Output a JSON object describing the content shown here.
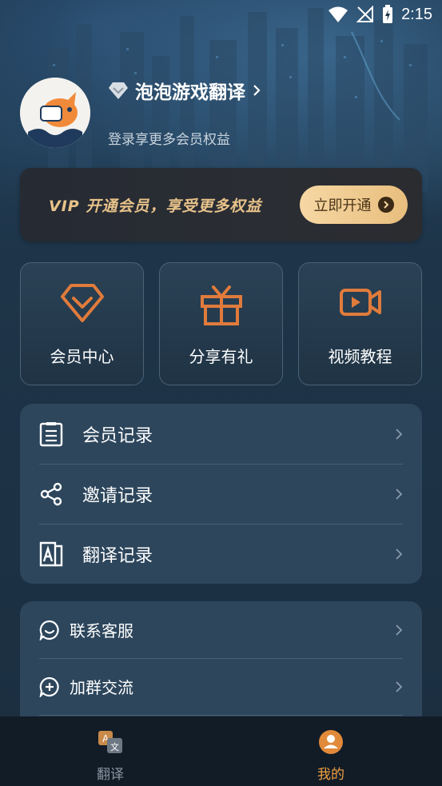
{
  "status_bar": {
    "time": "2:15"
  },
  "profile": {
    "app_name": "泡泡游戏翻译",
    "subtitle": "登录享更多会员权益"
  },
  "vip_banner": {
    "text": "VIP 开通会员，享受更多权益",
    "button_label": "立即开通"
  },
  "features": [
    {
      "label": "会员中心",
      "icon": "diamond-icon"
    },
    {
      "label": "分享有礼",
      "icon": "gift-icon"
    },
    {
      "label": "视频教程",
      "icon": "video-icon"
    }
  ],
  "records": [
    {
      "label": "会员记录",
      "icon": "clipboard-icon"
    },
    {
      "label": "邀请记录",
      "icon": "share-icon"
    },
    {
      "label": "翻译记录",
      "icon": "translate-a-icon"
    }
  ],
  "services": [
    {
      "label": "联系客服",
      "icon": "chat-icon"
    },
    {
      "label": "加群交流",
      "icon": "add-group-icon"
    }
  ],
  "bottom_nav": [
    {
      "label": "翻译",
      "icon": "translate-icon",
      "active": false
    },
    {
      "label": "我的",
      "icon": "profile-icon",
      "active": true
    }
  ],
  "colors": {
    "accent_orange": "#e07b3c",
    "vip_gold": "#e8c38a",
    "nav_active": "#f0a040",
    "nav_inactive": "#8a96a3"
  }
}
